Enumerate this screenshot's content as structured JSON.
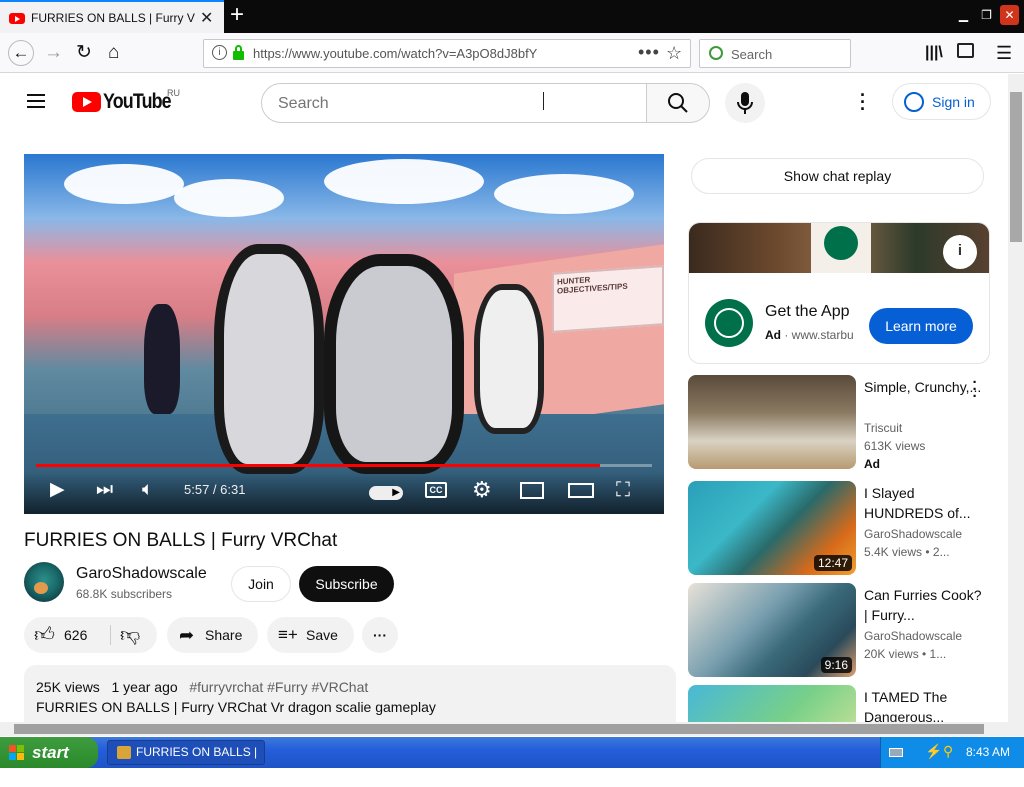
{
  "browser": {
    "tab_title": "FURRIES ON BALLS | Furry VRChat",
    "url": "https://www.youtube.com/watch?v=A3pO8dJ8bfY",
    "search_placeholder": "Search"
  },
  "yt": {
    "region": "RU",
    "logo_text": "YouTube",
    "search_placeholder": "Search",
    "signin": "Sign in"
  },
  "video": {
    "time": "5:57 / 6:31",
    "progress": 0.916,
    "sign_text": "HUNTER OBJECTIVES/TIPS",
    "title": "FURRIES ON BALLS | Furry VRChat",
    "channel": "GaroShadowscale",
    "subscribers": "68.8K subscribers",
    "join": "Join",
    "subscribe": "Subscribe",
    "likes": "626",
    "share": "Share",
    "save": "Save",
    "views": "25K views",
    "age": "1 year ago",
    "tags": "#furryvrchat #Furry #VRChat",
    "desc_line": "FURRIES ON BALLS | Furry VRChat Vr dragon scalie gameplay"
  },
  "sidebar": {
    "chat_replay": "Show chat replay",
    "ad": {
      "title": "Get the App",
      "label": "Ad",
      "domain": "www.starbu",
      "cta": "Learn more"
    },
    "recs": [
      {
        "title": "Simple, Crunchy,...",
        "channel": "Triscuit",
        "views": "613K views",
        "badge": "Ad",
        "duration": ""
      },
      {
        "title": "I Slayed HUNDREDS of...",
        "channel": "GaroShadowscale",
        "views": "5.4K views • 2...",
        "badge": "",
        "duration": "12:47"
      },
      {
        "title": "Can Furries Cook? | Furry...",
        "channel": "GaroShadowscale",
        "views": "20K views • 1...",
        "badge": "",
        "duration": "9:16"
      },
      {
        "title": "I TAMED The Dangerous...",
        "channel": "",
        "views": "",
        "badge": "",
        "duration": ""
      }
    ]
  },
  "taskbar": {
    "start": "start",
    "task": "FURRIES ON BALLS | ...",
    "clock": "8:43 AM"
  },
  "colors": {
    "yt_red": "#ff0000",
    "link_blue": "#065fd4",
    "xp_blue": "#245edb",
    "xp_green": "#2a8a2a"
  }
}
